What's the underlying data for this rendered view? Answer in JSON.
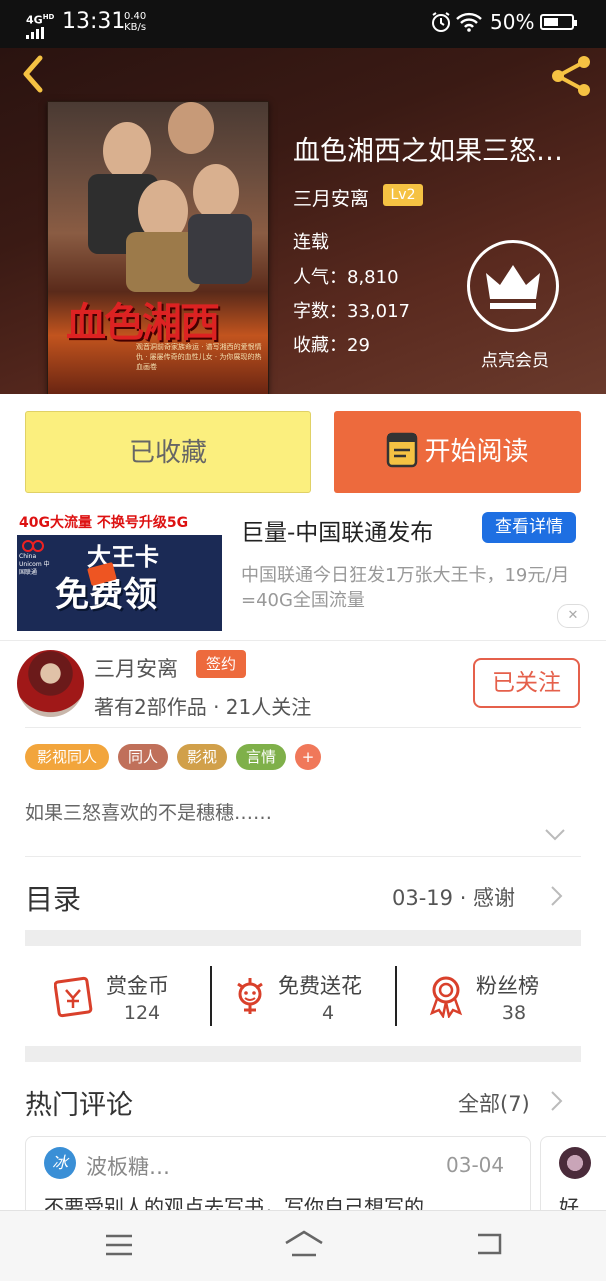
{
  "status_bar": {
    "network": "4G",
    "network_sup": "HD",
    "time": "13:31",
    "speed_value": "0.40",
    "speed_unit": "KB/s",
    "battery": "50%"
  },
  "book": {
    "title": "血色湘西之如果三怒…",
    "author": "三月安离",
    "level": "Lv2",
    "status": "连载",
    "popularity_label": "人气：",
    "popularity": "8,810",
    "words_label": "字数：",
    "words": "33,017",
    "favorites_label": "收藏：",
    "favorites": "29",
    "cover_title": "血色湘西",
    "cover_tagline": "观音洞前奇家族命运 · 谱写湘西的爱恨情仇 · 屡屡传奇的血性儿女 · 为你展现的热血画卷"
  },
  "member": {
    "label": "点亮会员"
  },
  "buttons": {
    "collected": "已收藏",
    "read": "开始阅读"
  },
  "ad": {
    "banner_top": "40G大流量 不换号升级5G",
    "banner_card": "大王卡",
    "banner_free": "免费领",
    "banner_brand": "China Unicom 中国联通",
    "title": "巨量-中国联通发布",
    "detail_button": "查看详情",
    "description": "中国联通今日狂发1万张大王卡，19元/月=40G全国流量",
    "close": "✕"
  },
  "author_card": {
    "name": "三月安离",
    "badge": "签约",
    "info": "著有2部作品 · 21人关注",
    "follow": "已关注"
  },
  "tags": [
    {
      "label": "影视同人",
      "color": "#f2a53c"
    },
    {
      "label": "同人",
      "color": "#c0705a"
    },
    {
      "label": "影视",
      "color": "#d1a04a"
    },
    {
      "label": "言情",
      "color": "#7fb04a"
    },
    {
      "label": "+",
      "color": "#f0785a"
    }
  ],
  "synopsis": "如果三怒喜欢的不是穗穗……",
  "toc": {
    "label": "目录",
    "latest": "03-19 · 感谢"
  },
  "gifts": [
    {
      "label": "赏金币",
      "value": "124",
      "icon": "coin-icon"
    },
    {
      "label": "免费送花",
      "value": "4",
      "icon": "flower-icon"
    },
    {
      "label": "粉丝榜",
      "value": "38",
      "icon": "ribbon-icon"
    }
  ],
  "comments": {
    "heading": "热门评论",
    "all": "全部(7)",
    "items": [
      {
        "user": "波板糖…",
        "date": "03-04",
        "text": "不要受别人的观点去写书，写你自己想写的",
        "avatar_text": "冰"
      },
      {
        "user": "",
        "date": "",
        "text": "好",
        "avatar_text": ""
      }
    ]
  },
  "colors": {
    "accent_orange": "#ed6a3d",
    "collected_yellow": "#fbef7e",
    "vip_gold": "#f5c243",
    "link_blue": "#1e6fe2"
  }
}
